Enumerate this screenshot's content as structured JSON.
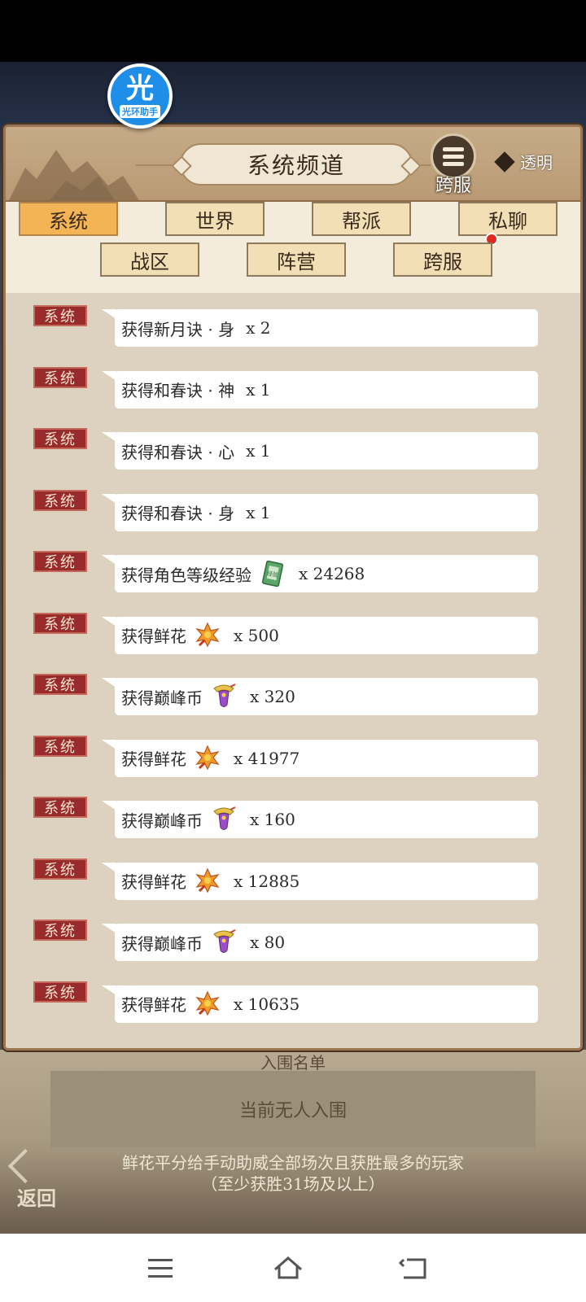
{
  "badge": {
    "big": "光",
    "small": "光环助手"
  },
  "panel": {
    "title": "系统频道",
    "cross_server_label": "跨服",
    "transparent_label": "透明"
  },
  "tabs": [
    {
      "label": "系统",
      "active": true
    },
    {
      "label": "世界",
      "active": false
    },
    {
      "label": "帮派",
      "active": false
    },
    {
      "label": "私聊",
      "active": false,
      "notify": true
    },
    {
      "label": "战区",
      "active": false
    },
    {
      "label": "阵营",
      "active": false
    },
    {
      "label": "跨服",
      "active": false
    }
  ],
  "messages": [
    {
      "badge": "系统",
      "text": "获得新月诀 · 身",
      "icon": "",
      "qty": "x 2"
    },
    {
      "badge": "系统",
      "text": "获得和春诀 · 神",
      "icon": "",
      "qty": "x 1"
    },
    {
      "badge": "系统",
      "text": "获得和春诀 · 心",
      "icon": "",
      "qty": "x 1"
    },
    {
      "badge": "系统",
      "text": "获得和春诀 · 身",
      "icon": "",
      "qty": "x 1"
    },
    {
      "badge": "系统",
      "text": "获得角色等级经验",
      "icon": "exp-book-icon",
      "qty": "x 24268"
    },
    {
      "badge": "系统",
      "text": "获得鲜花",
      "icon": "flower-icon",
      "qty": "x 500"
    },
    {
      "badge": "系统",
      "text": "获得巅峰币",
      "icon": "peak-coin-icon",
      "qty": "x 320"
    },
    {
      "badge": "系统",
      "text": "获得鲜花",
      "icon": "flower-icon",
      "qty": "x 41977"
    },
    {
      "badge": "系统",
      "text": "获得巅峰币",
      "icon": "peak-coin-icon",
      "qty": "x 160"
    },
    {
      "badge": "系统",
      "text": "获得鲜花",
      "icon": "flower-icon",
      "qty": "x 12885"
    },
    {
      "badge": "系统",
      "text": "获得巅峰币",
      "icon": "peak-coin-icon",
      "qty": "x 80"
    },
    {
      "badge": "系统",
      "text": "获得鲜花",
      "icon": "flower-icon",
      "qty": "x 10635"
    }
  ],
  "background": {
    "title": "入围名单",
    "empty_text": "当前无人入围",
    "description": "鲜花平分给手动助威全部场次且获胜最多的玩家（至少获胜31场及以上）",
    "back_label": "返回"
  },
  "exp_book_label": "经验",
  "nav": [
    "menu-icon",
    "home-icon",
    "back-icon"
  ]
}
